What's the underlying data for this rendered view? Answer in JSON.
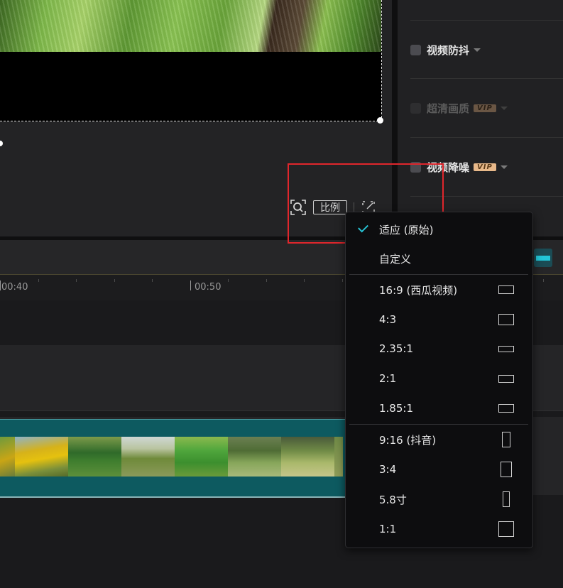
{
  "preview": {
    "ratio_button_label": "比例"
  },
  "right_panel": {
    "items": [
      {
        "label": "视频防抖",
        "vip": "",
        "enabled": true
      },
      {
        "label": "超清画质",
        "vip": "VIP",
        "enabled": false
      },
      {
        "label": "视频降噪",
        "vip": "VIP",
        "enabled": true
      }
    ]
  },
  "timeline": {
    "ruler_labels": [
      "00:40",
      "00:50"
    ]
  },
  "ratio_menu": {
    "selected_index": 0,
    "items": [
      {
        "label": "适应 (原始)",
        "icon": ""
      },
      {
        "label": "自定义",
        "icon": ""
      },
      {
        "label": "16:9 (西瓜视频)",
        "icon": "ratio-16-9-icon"
      },
      {
        "label": "4:3",
        "icon": "ratio-4-3-icon"
      },
      {
        "label": "2.35:1",
        "icon": "ratio-2-35-1-icon"
      },
      {
        "label": "2:1",
        "icon": "ratio-2-1-icon"
      },
      {
        "label": "1.85:1",
        "icon": "ratio-1-85-1-icon"
      },
      {
        "label": "9:16 (抖音)",
        "icon": "ratio-9-16-icon"
      },
      {
        "label": "3:4",
        "icon": "ratio-3-4-icon"
      },
      {
        "label": "5.8寸",
        "icon": "ratio-5-8-icon"
      },
      {
        "label": "1:1",
        "icon": "ratio-1-1-icon"
      }
    ]
  },
  "colors": {
    "accent": "#26c2d4",
    "highlight_box": "#e0262c",
    "clip": "#0d5a60",
    "vip_badge": "#e8b98a"
  }
}
